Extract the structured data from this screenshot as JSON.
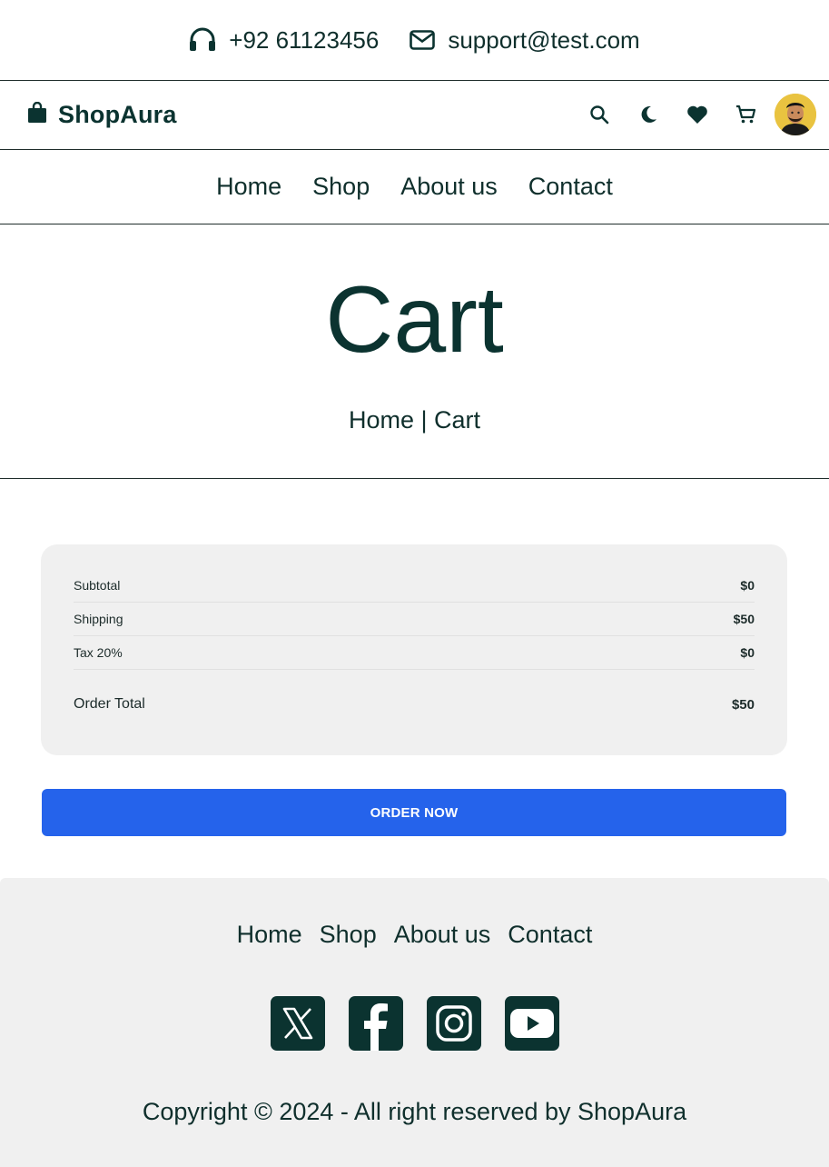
{
  "topbar": {
    "phone": "+92 61123456",
    "email": "support@test.com",
    "phone_icon": "headphones-icon",
    "email_icon": "envelope-icon"
  },
  "header": {
    "brand": "ShopAura",
    "brand_icon": "shopping-bag-icon",
    "icons": [
      "search-icon",
      "moon-icon",
      "heart-icon",
      "cart-icon",
      "user-avatar"
    ]
  },
  "nav": {
    "items": [
      "Home",
      "Shop",
      "About us",
      "Contact"
    ]
  },
  "hero": {
    "title": "Cart",
    "breadcrumb_home": "Home",
    "breadcrumb_sep": "|",
    "breadcrumb_current": "Cart"
  },
  "summary": {
    "rows": [
      {
        "label": "Subtotal",
        "value": "$0"
      },
      {
        "label": "Shipping",
        "value": "$50"
      },
      {
        "label": "Tax 20%",
        "value": "$0"
      }
    ],
    "total_label": "Order Total",
    "total_value": "$50"
  },
  "order_button": "ORDER NOW",
  "footer": {
    "nav": [
      "Home",
      "Shop",
      "About us",
      "Contact"
    ],
    "social": [
      "x-icon",
      "facebook-icon",
      "instagram-icon",
      "youtube-icon"
    ],
    "copyright": "Copyright © 2024 - All right reserved by ShopAura"
  },
  "colors": {
    "primary_text": "#0b3330",
    "accent_button": "#2563eb",
    "panel_bg": "#f0f0f0",
    "avatar_bg": "#e9c340"
  }
}
